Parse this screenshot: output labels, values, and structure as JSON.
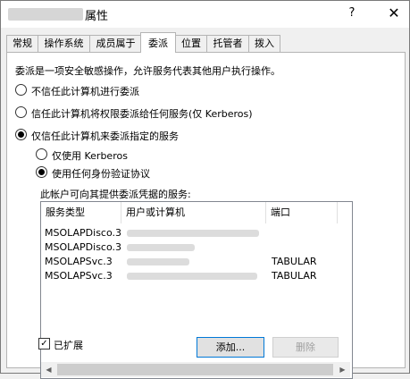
{
  "window": {
    "title": "属性",
    "help_glyph": "?",
    "close_glyph": "✕"
  },
  "tabs": [
    "常规",
    "操作系统",
    "成员属于",
    "委派",
    "位置",
    "托管者",
    "拨入"
  ],
  "description": "委派是一项安全敏感操作，允许服务代表其他用户执行操作。",
  "options": {
    "no_trust": "不信任此计算机进行委派",
    "trust_any": "信任此计算机将权限委派给任何服务(仅 Kerberos)",
    "trust_specified": "仅信任此计算机来委派指定的服务",
    "kerberos_only": "仅使用 Kerberos",
    "any_protocol": "使用任何身份验证协议"
  },
  "services_label": "此帐户可向其提供委派凭据的服务:",
  "table": {
    "columns": [
      "服务类型",
      "用户或计算机",
      "端口"
    ],
    "rows": [
      {
        "service": "MSOLAPDisco.3",
        "port": ""
      },
      {
        "service": "MSOLAPDisco.3",
        "port": ""
      },
      {
        "service": "MSOLAPSvc.3",
        "port": "TABULAR"
      },
      {
        "service": "MSOLAPSvc.3",
        "port": "TABULAR"
      }
    ]
  },
  "expanded_label": "已扩展",
  "buttons": {
    "add": "添加...",
    "remove": "删除"
  }
}
